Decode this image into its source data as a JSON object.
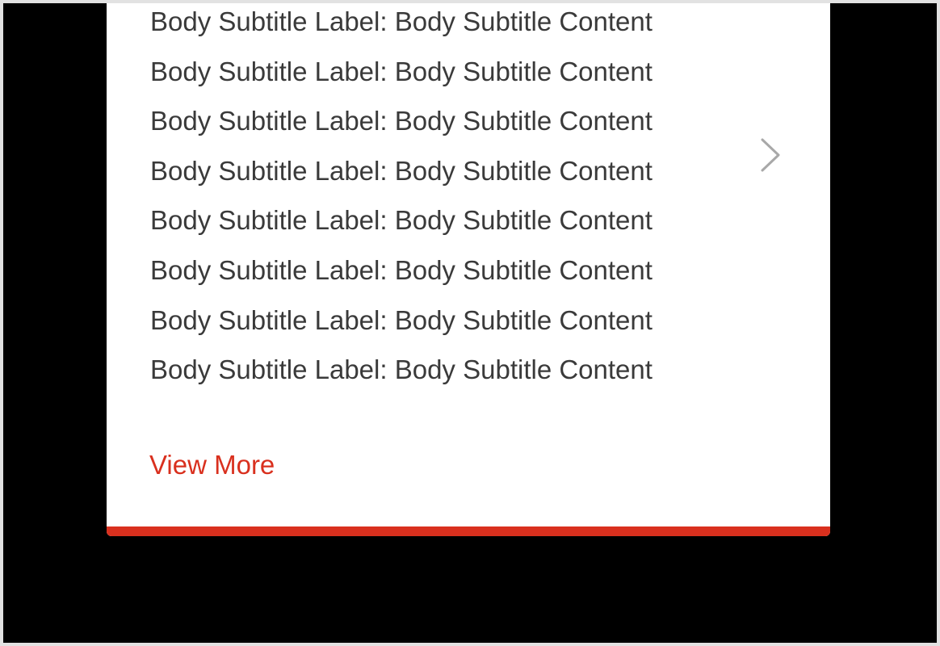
{
  "card": {
    "rows": [
      {
        "label": "Body Subtitle Label:",
        "content": "Body Subtitle Content"
      },
      {
        "label": "Body Subtitle Label:",
        "content": "Body Subtitle Content"
      },
      {
        "label": "Body Subtitle Label:",
        "content": "Body Subtitle Content"
      },
      {
        "label": "Body Subtitle Label:",
        "content": "Body Subtitle Content"
      },
      {
        "label": "Body Subtitle Label:",
        "content": "Body Subtitle Content"
      },
      {
        "label": "Body Subtitle Label:",
        "content": "Body Subtitle Content"
      },
      {
        "label": "Body Subtitle Label:",
        "content": "Body Subtitle Content"
      },
      {
        "label": "Body Subtitle Label:",
        "content": "Body Subtitle Content"
      }
    ],
    "chevron_icon": "chevron-right-icon",
    "view_more_label": "View More"
  },
  "colors": {
    "accent": "#d9301e",
    "text": "#3a3a3a",
    "chevron": "#a8a8a8",
    "background": "#000000",
    "card": "#ffffff"
  }
}
